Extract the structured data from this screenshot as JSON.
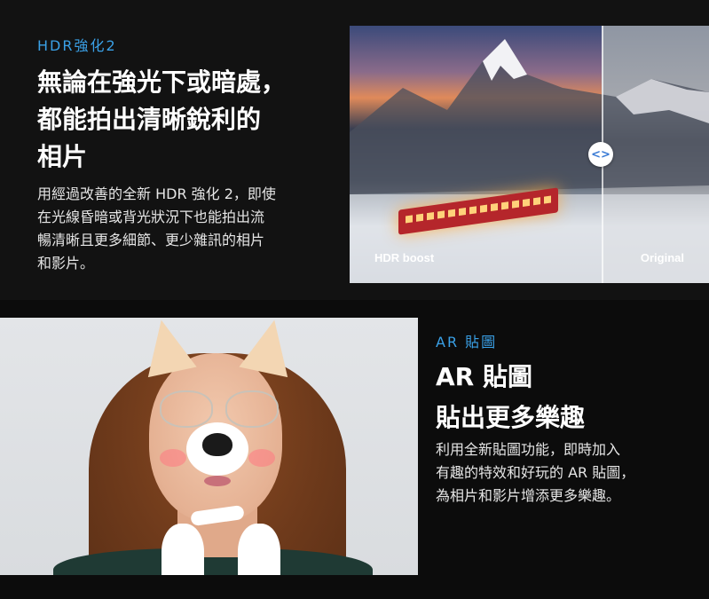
{
  "hdr": {
    "eyebrow": "HDR強化2",
    "headline": [
      "無論在強光下或暗處，",
      "都能拍出清晰銳利的",
      "相片"
    ],
    "body": [
      "用經過改善的全新 HDR 強化 2，即使",
      "在光線昏暗或背光狀況下也能拍出流",
      "暢清晰且更多細節、更少雜訊的相片",
      "和影片。"
    ],
    "image": {
      "left_label": "HDR boost",
      "right_label": "Original",
      "handle_icon": "<>"
    }
  },
  "ar": {
    "eyebrow": "AR 貼圖",
    "headline": [
      "AR 貼圖",
      "貼出更多樂趣"
    ],
    "body": [
      "利用全新貼圖功能，即時加入",
      "有趣的特效和好玩的 AR 貼圖，",
      "為相片和影片增添更多樂趣。"
    ]
  },
  "colors": {
    "accent": "#3aa0e6",
    "background": "#111111",
    "text": "#ffffff"
  }
}
